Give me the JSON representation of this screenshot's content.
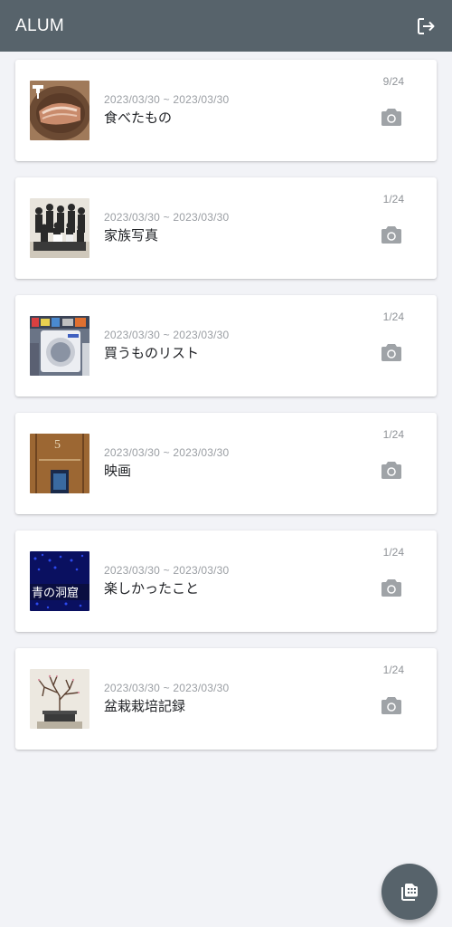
{
  "app": {
    "title": "ALUM",
    "header_icon": "logout-icon",
    "fab_icon": "add-album-icon",
    "colors": {
      "header": "#57636b",
      "background": "#f2f3f7",
      "icon_gray": "#9fa3a7"
    }
  },
  "albums": [
    {
      "dates": "2023/03/30 ~ 2023/03/30",
      "title": "食べたもの",
      "count": "9/24",
      "thumb": "food"
    },
    {
      "dates": "2023/03/30 ~ 2023/03/30",
      "title": "家族写真",
      "count": "1/24",
      "thumb": "family"
    },
    {
      "dates": "2023/03/30 ~ 2023/03/30",
      "title": "買うものリスト",
      "count": "1/24",
      "thumb": "appliance"
    },
    {
      "dates": "2023/03/30 ~ 2023/03/30",
      "title": "映画",
      "count": "1/24",
      "thumb": "theater"
    },
    {
      "dates": "2023/03/30 ~ 2023/03/30",
      "title": "楽しかったこと",
      "count": "1/24",
      "thumb": "cave"
    },
    {
      "dates": "2023/03/30 ~ 2023/03/30",
      "title": "盆栽栽培記録",
      "count": "1/24",
      "thumb": "bonsai"
    }
  ],
  "thumb_texts": {
    "cave_sign": "青の洞窟",
    "theater_number": "5"
  }
}
